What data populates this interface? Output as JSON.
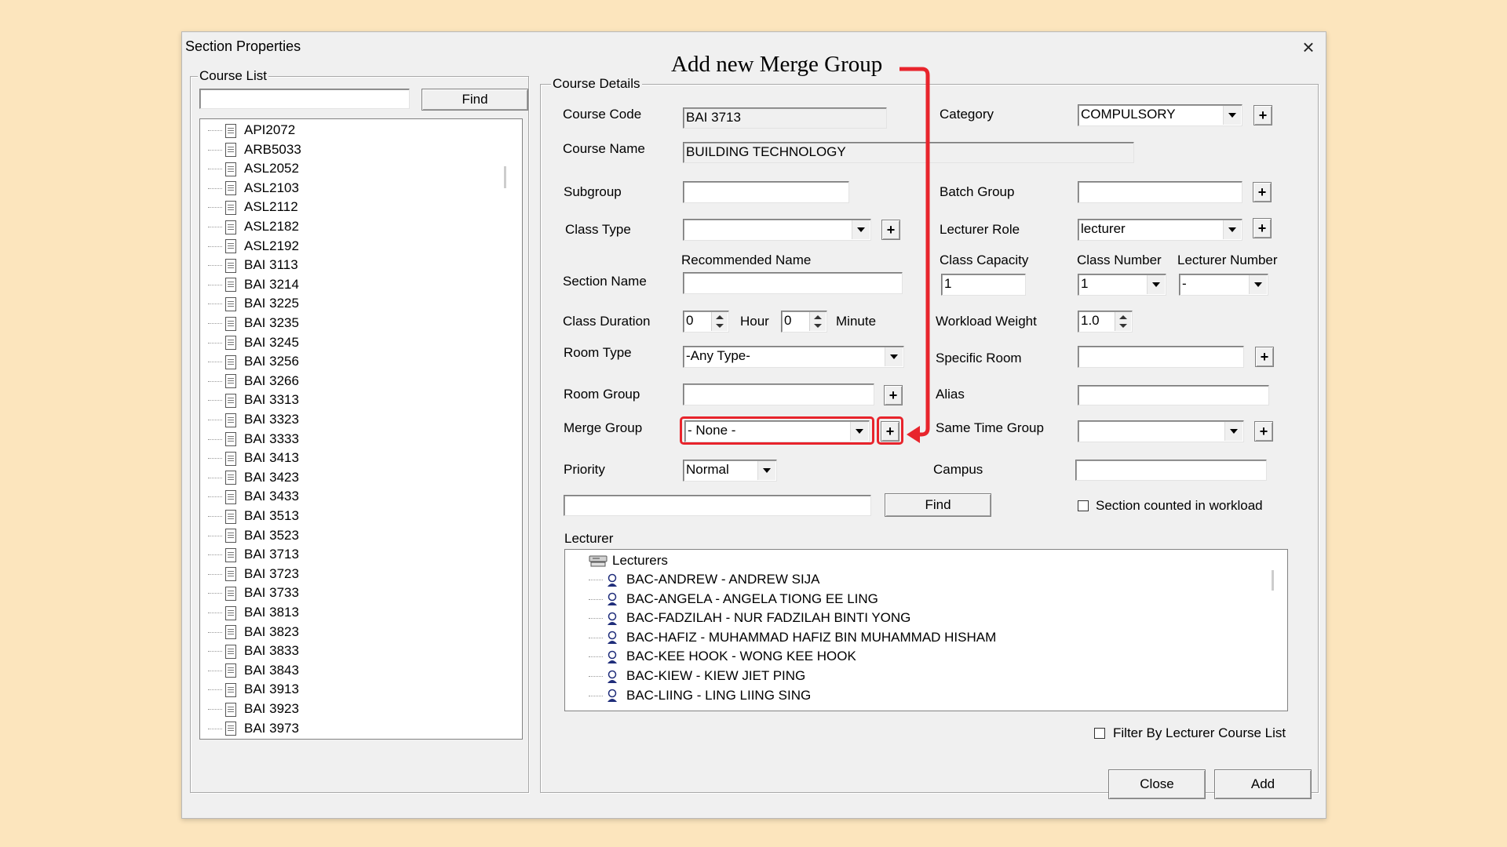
{
  "window": {
    "title": "Section Properties",
    "close_label": "×"
  },
  "annotation": {
    "text": "Add new Merge Group",
    "color": "#e8242c"
  },
  "course_list": {
    "legend": "Course List",
    "search_value": "",
    "find_label": "Find",
    "items": [
      "API2072",
      "ARB5033",
      "ASL2052",
      "ASL2103",
      "ASL2112",
      "ASL2182",
      "ASL2192",
      "BAI 3113",
      "BAI 3214",
      "BAI 3225",
      "BAI 3235",
      "BAI 3245",
      "BAI 3256",
      "BAI 3266",
      "BAI 3313",
      "BAI 3323",
      "BAI 3333",
      "BAI 3413",
      "BAI 3423",
      "BAI 3433",
      "BAI 3513",
      "BAI 3523",
      "BAI 3713",
      "BAI 3723",
      "BAI 3733",
      "BAI 3813",
      "BAI 3823",
      "BAI 3833",
      "BAI 3843",
      "BAI 3913",
      "BAI 3923",
      "BAI 3973"
    ]
  },
  "course_details": {
    "legend": "Course Details",
    "course_code": {
      "label": "Course Code",
      "value": "BAI 3713"
    },
    "course_name": {
      "label": "Course Name",
      "value": "BUILDING TECHNOLOGY"
    },
    "category": {
      "label": "Category",
      "value": "COMPULSORY"
    },
    "subgroup": {
      "label": "Subgroup",
      "value": ""
    },
    "batch_group": {
      "label": "Batch Group",
      "value": ""
    },
    "class_type": {
      "label": "Class Type",
      "value": ""
    },
    "lecturer_role": {
      "label": "Lecturer Role",
      "value": "lecturer"
    },
    "recommended_name_label": "Recommended Name",
    "section_name": {
      "label": "Section Name",
      "value": ""
    },
    "class_capacity": {
      "label": "Class Capacity",
      "value": "1"
    },
    "class_number": {
      "label": "Class Number",
      "value": "1"
    },
    "lecturer_number": {
      "label": "Lecturer Number",
      "value": "-"
    },
    "class_duration": {
      "label": "Class Duration",
      "hour_value": "0",
      "hour_label": "Hour",
      "minute_value": "0",
      "minute_label": "Minute"
    },
    "workload_weight": {
      "label": "Workload Weight",
      "value": "1.0"
    },
    "room_type": {
      "label": "Room Type",
      "value": "-Any Type-"
    },
    "specific_room": {
      "label": "Specific Room",
      "value": ""
    },
    "room_group": {
      "label": "Room Group",
      "value": ""
    },
    "alias": {
      "label": "Alias",
      "value": ""
    },
    "merge_group": {
      "label": "Merge Group",
      "value": "- None -"
    },
    "same_time_group": {
      "label": "Same Time Group",
      "value": ""
    },
    "priority": {
      "label": "Priority",
      "value": "Normal"
    },
    "campus": {
      "label": "Campus",
      "value": ""
    },
    "lecturer_search_value": "",
    "find_label": "Find",
    "section_counted_label": "Section counted in workload",
    "plus_label": "+"
  },
  "lecturer": {
    "label": "Lecturer",
    "root": "Lecturers",
    "items": [
      "BAC-ANDREW - ANDREW SIJA",
      "BAC-ANGELA - ANGELA TIONG EE LING",
      "BAC-FADZILAH - NUR FADZILAH BINTI YONG",
      "BAC-HAFIZ - MUHAMMAD HAFIZ BIN MUHAMMAD HISHAM",
      "BAC-KEE HOOK - WONG KEE HOOK",
      "BAC-KIEW - KIEW JIET PING",
      "BAC-LIING - LING LIING SING"
    ],
    "filter_label": "Filter By Lecturer Course List"
  },
  "footer": {
    "close_label": "Close",
    "add_label": "Add"
  }
}
